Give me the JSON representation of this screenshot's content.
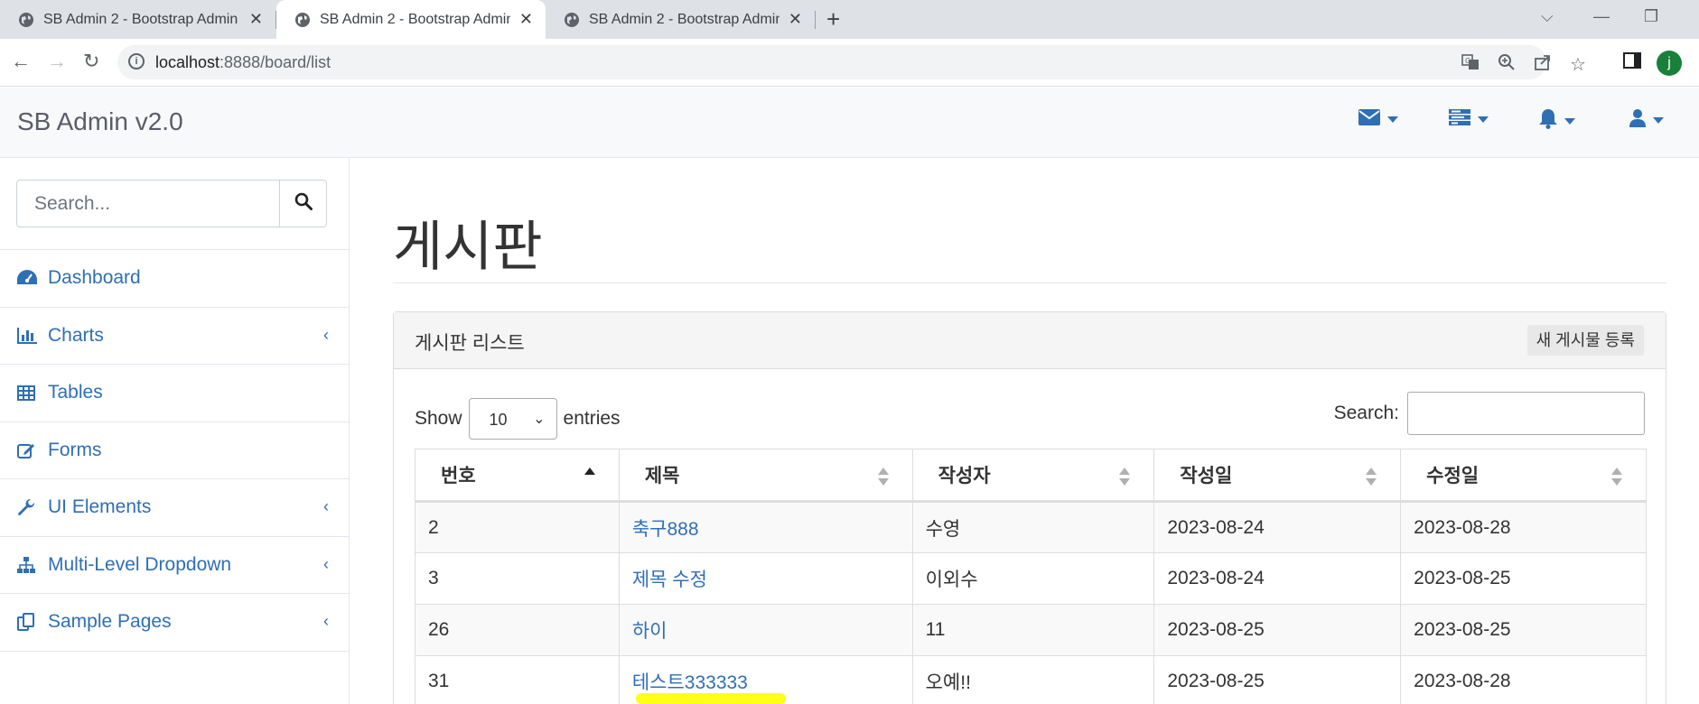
{
  "browser": {
    "tabs": [
      {
        "title": "SB Admin 2 - Bootstrap Admin"
      },
      {
        "title": "SB Admin 2 - Bootstrap Admin"
      },
      {
        "title": "SB Admin 2 - Bootstrap Admin"
      }
    ],
    "active_tab": 1,
    "url_host": "localhost",
    "url_rest": ":8888/board/list",
    "profile_initial": "j"
  },
  "topbar": {
    "brand": "SB Admin v2.0",
    "icons": [
      "envelope-icon",
      "tasks-icon",
      "bell-icon",
      "user-icon"
    ]
  },
  "sidebar": {
    "search_placeholder": "Search...",
    "items": [
      {
        "label": "Dashboard",
        "icon": "dashboard-icon",
        "has_submenu": false
      },
      {
        "label": "Charts",
        "icon": "bar-chart-icon",
        "has_submenu": true
      },
      {
        "label": "Tables",
        "icon": "table-icon",
        "has_submenu": false
      },
      {
        "label": "Forms",
        "icon": "edit-icon",
        "has_submenu": false
      },
      {
        "label": "UI Elements",
        "icon": "wrench-icon",
        "has_submenu": true
      },
      {
        "label": "Multi-Level Dropdown",
        "icon": "sitemap-icon",
        "has_submenu": true
      },
      {
        "label": "Sample Pages",
        "icon": "files-icon",
        "has_submenu": true
      }
    ]
  },
  "main": {
    "page_title": "게시판",
    "panel_title": "게시판 리스트",
    "new_post_label": "새 게시물 등록",
    "show_label": "Show",
    "entries_value": "10",
    "entries_label": "entries",
    "search_label": "Search:",
    "columns": [
      "번호",
      "제목",
      "작성자",
      "작성일",
      "수정일"
    ],
    "rows": [
      {
        "no": "2",
        "title": "축구888",
        "author": "수영",
        "created": "2023-08-24",
        "updated": "2023-08-28"
      },
      {
        "no": "3",
        "title": "제목 수정",
        "author": "이외수",
        "created": "2023-08-24",
        "updated": "2023-08-25"
      },
      {
        "no": "26",
        "title": "하이",
        "author": "11",
        "created": "2023-08-25",
        "updated": "2023-08-25"
      },
      {
        "no": "31",
        "title": "테스트333333",
        "author": "오예!!",
        "created": "2023-08-25",
        "updated": "2023-08-28"
      }
    ],
    "highlight_color": "#ffff00",
    "link_color": "#2f6fb4"
  }
}
